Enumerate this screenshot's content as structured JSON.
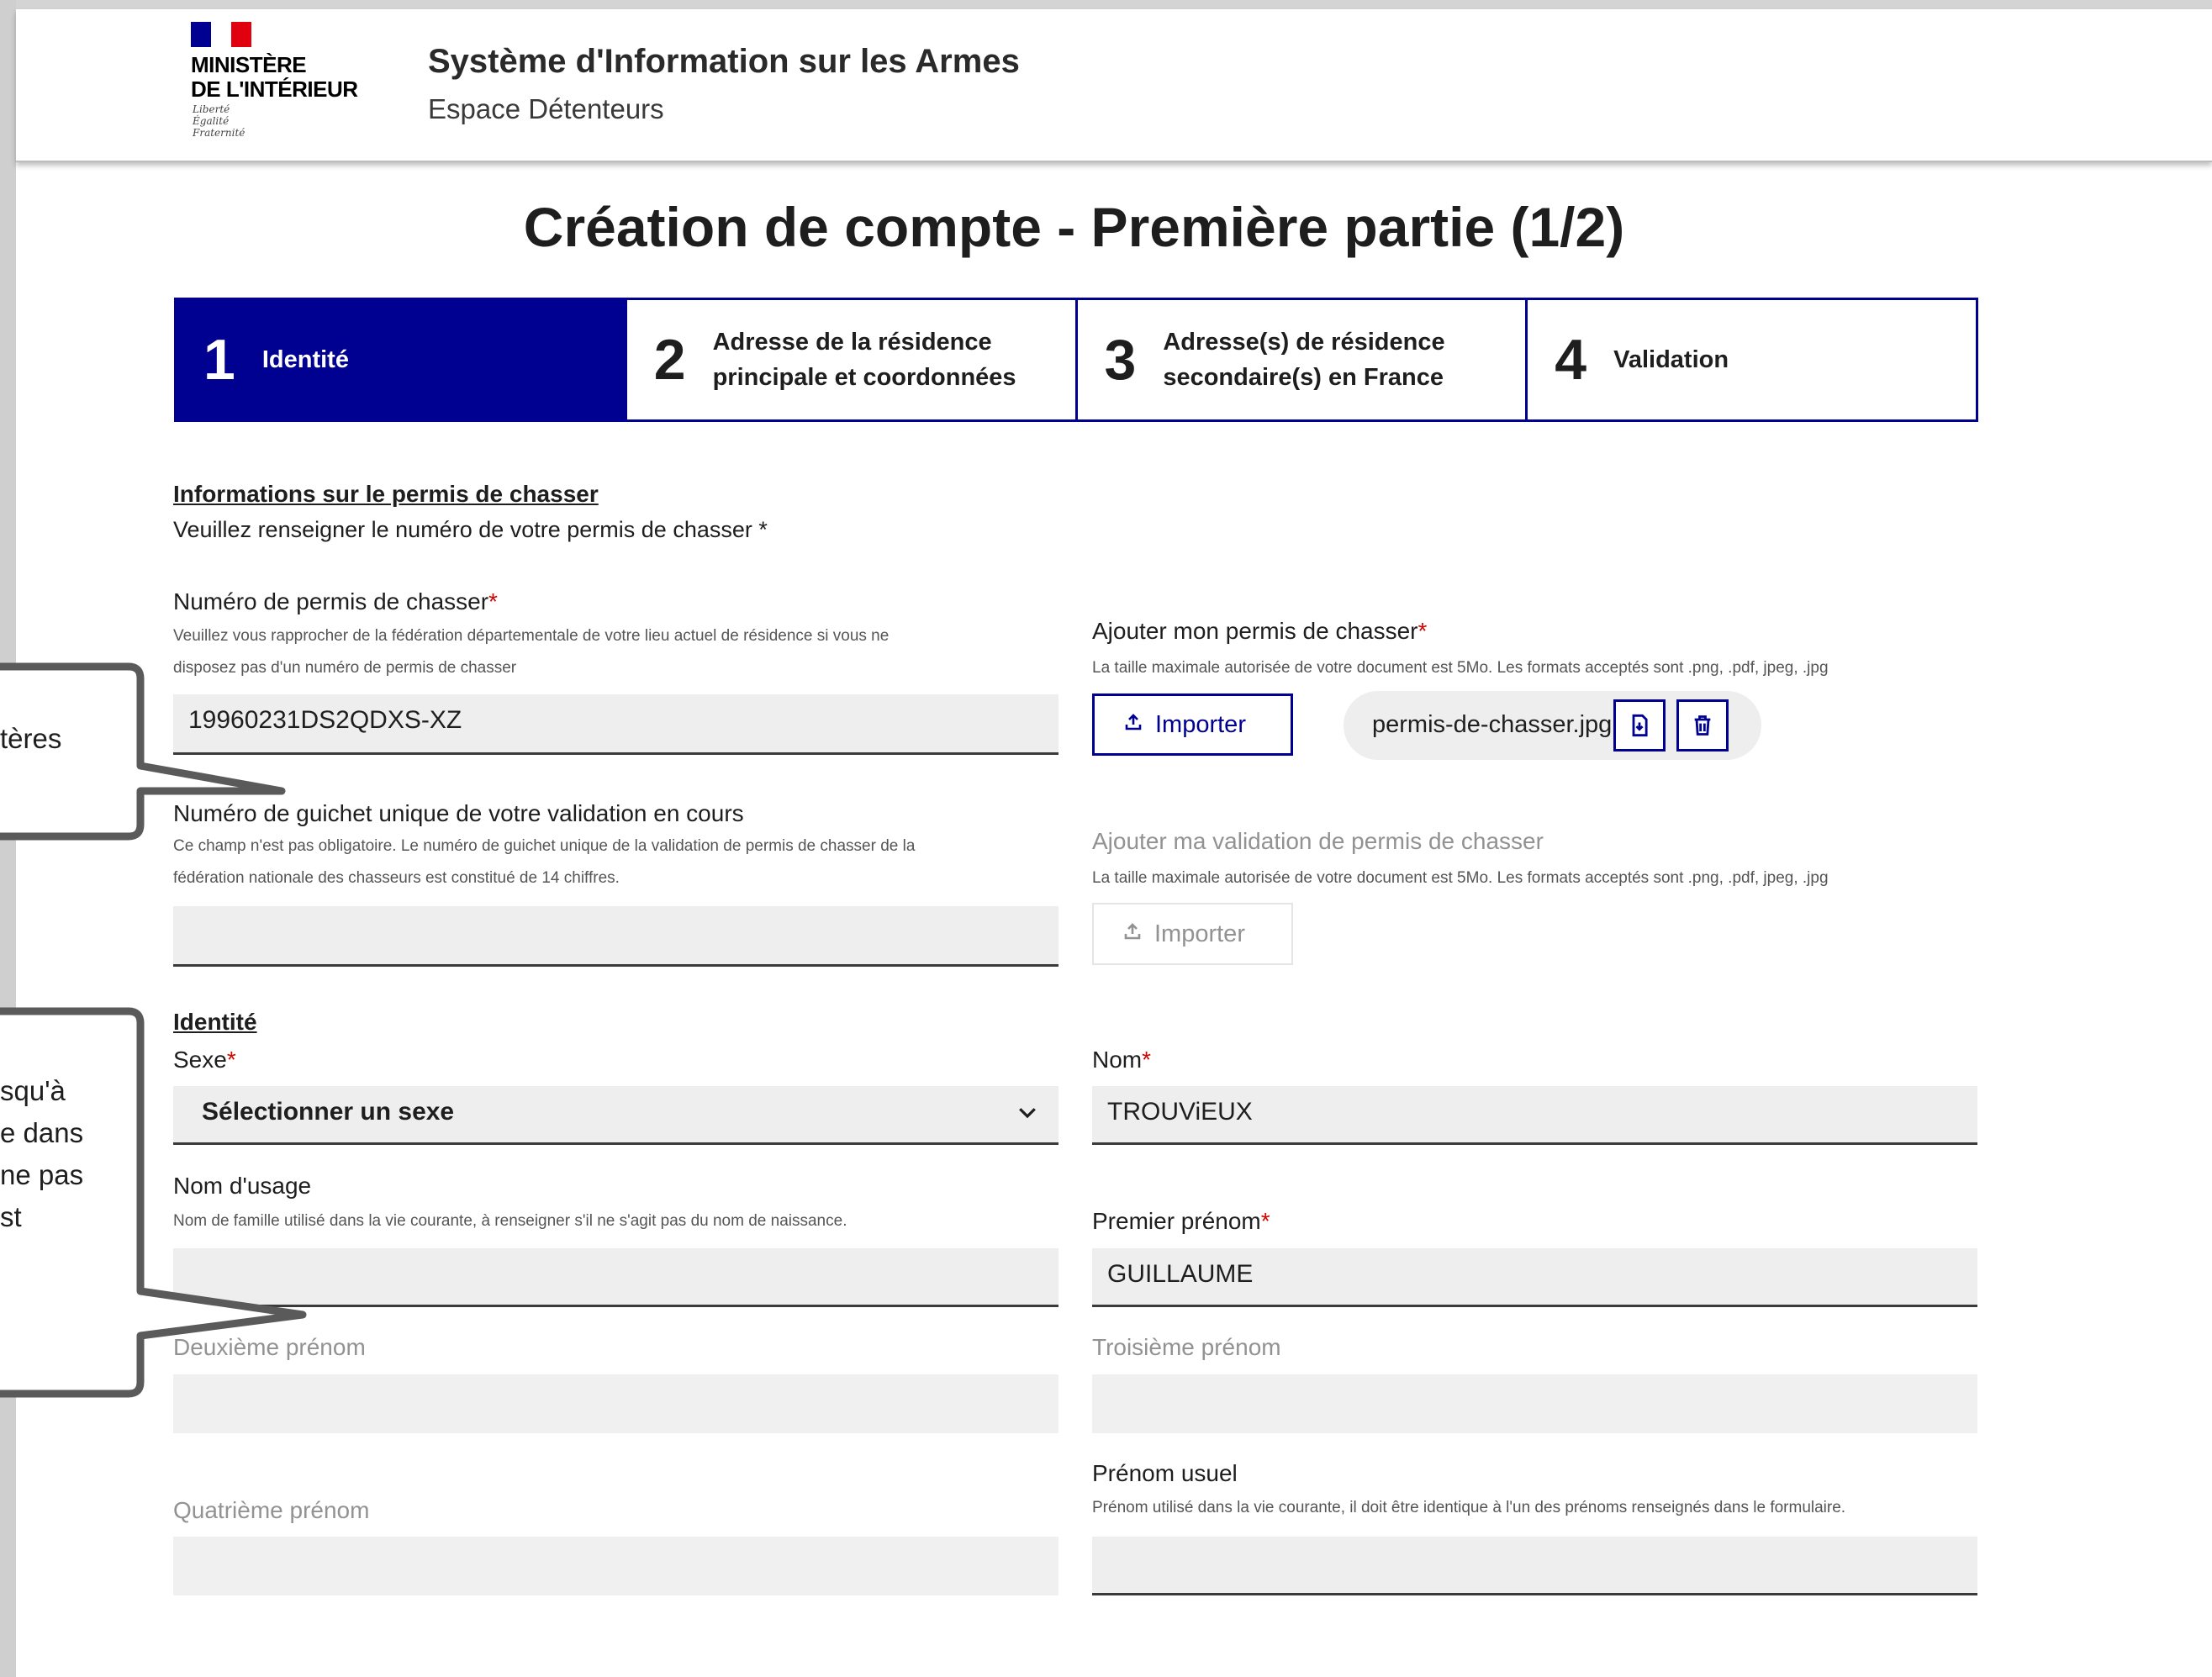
{
  "header": {
    "ministry_line1": "MINISTÈRE",
    "ministry_line2": "DE L'INTÉRIEUR",
    "motto1": "Liberté",
    "motto2": "Égalité",
    "motto3": "Fraternité",
    "title": "Système d'Information sur les Armes",
    "subtitle": "Espace Détenteurs"
  },
  "page": {
    "title": "Création de compte - Première partie (1/2)"
  },
  "stepper": [
    {
      "num": "1",
      "label": "Identité",
      "active": true
    },
    {
      "num": "2",
      "label": "Adresse de la résidence\nprincipale et coordonnées",
      "active": false
    },
    {
      "num": "3",
      "label": "Adresse(s) de résidence\nsecondaire(s) en France",
      "active": false
    },
    {
      "num": "4",
      "label": "Validation",
      "active": false
    }
  ],
  "permit": {
    "section_title": "Informations sur le permis de chasser",
    "intro": "Veuillez renseigner le numéro de votre permis de chasser *",
    "number_label": "Numéro de permis de chasser",
    "number_hint_1": "Veuillez vous rapprocher de la fédération départementale de votre lieu actuel de résidence si vous ne",
    "number_hint_2": "disposez pas d'un numéro de permis de chasser",
    "number_value": "19960231DS2QDXS-XZ",
    "guichet_label": "Numéro de guichet unique de votre validation en cours",
    "guichet_hint_1": "Ce champ n'est pas obligatoire. Le numéro de guichet unique de la validation de permis de chasser de la",
    "guichet_hint_2": "fédération nationale des chasseurs est constitué de 14 chiffres.",
    "guichet_value": "",
    "upload_label": "Ajouter mon permis de chasser",
    "upload_hint": "La taille maximale autorisée de votre document est 5Mo. Les formats acceptés sont .png, .pdf, jpeg, .jpg",
    "import_label": "Importer",
    "file_name": "permis-de-chasser.jpg",
    "validation_label": "Ajouter ma validation de permis de chasser",
    "validation_hint": "La taille maximale autorisée de votre document est 5Mo. Les formats acceptés sont .png, .pdf, jpeg, .jpg",
    "validation_import_label": "Importer"
  },
  "identity": {
    "section_title": "Identité",
    "sexe_label": "Sexe",
    "sexe_value": "Sélectionner un sexe",
    "nom_label": "Nom",
    "nom_value": "TROUViEUX",
    "usage_label": "Nom d'usage",
    "usage_hint": "Nom de famille utilisé dans la vie courante, à renseigner s'il ne s'agit pas du nom de naissance.",
    "usage_value": "",
    "prenom1_label": "Premier prénom",
    "prenom1_value": "GUILLAUME",
    "prenom2_label": "Deuxième prénom",
    "prenom3_label": "Troisième prénom",
    "prenom4_label": "Quatrième prénom",
    "usuel_label": "Prénom usuel",
    "usuel_hint": "Prénom utilisé dans la vie courante, il doit être identique à l'un des prénoms renseignés dans le formulaire.",
    "usuel_value": ""
  },
  "required_marker": "*",
  "callouts": {
    "top_text": "tères",
    "bottom_text": "squ'à\ne dans\nne pas\nst"
  },
  "colors": {
    "primary": "#000091",
    "required": "#ce0500",
    "field_bg": "#eeeeee"
  },
  "icons": {
    "upload": "upload-icon",
    "download": "file-download-icon",
    "delete": "trash-icon",
    "chevron": "chevron-down-icon"
  }
}
